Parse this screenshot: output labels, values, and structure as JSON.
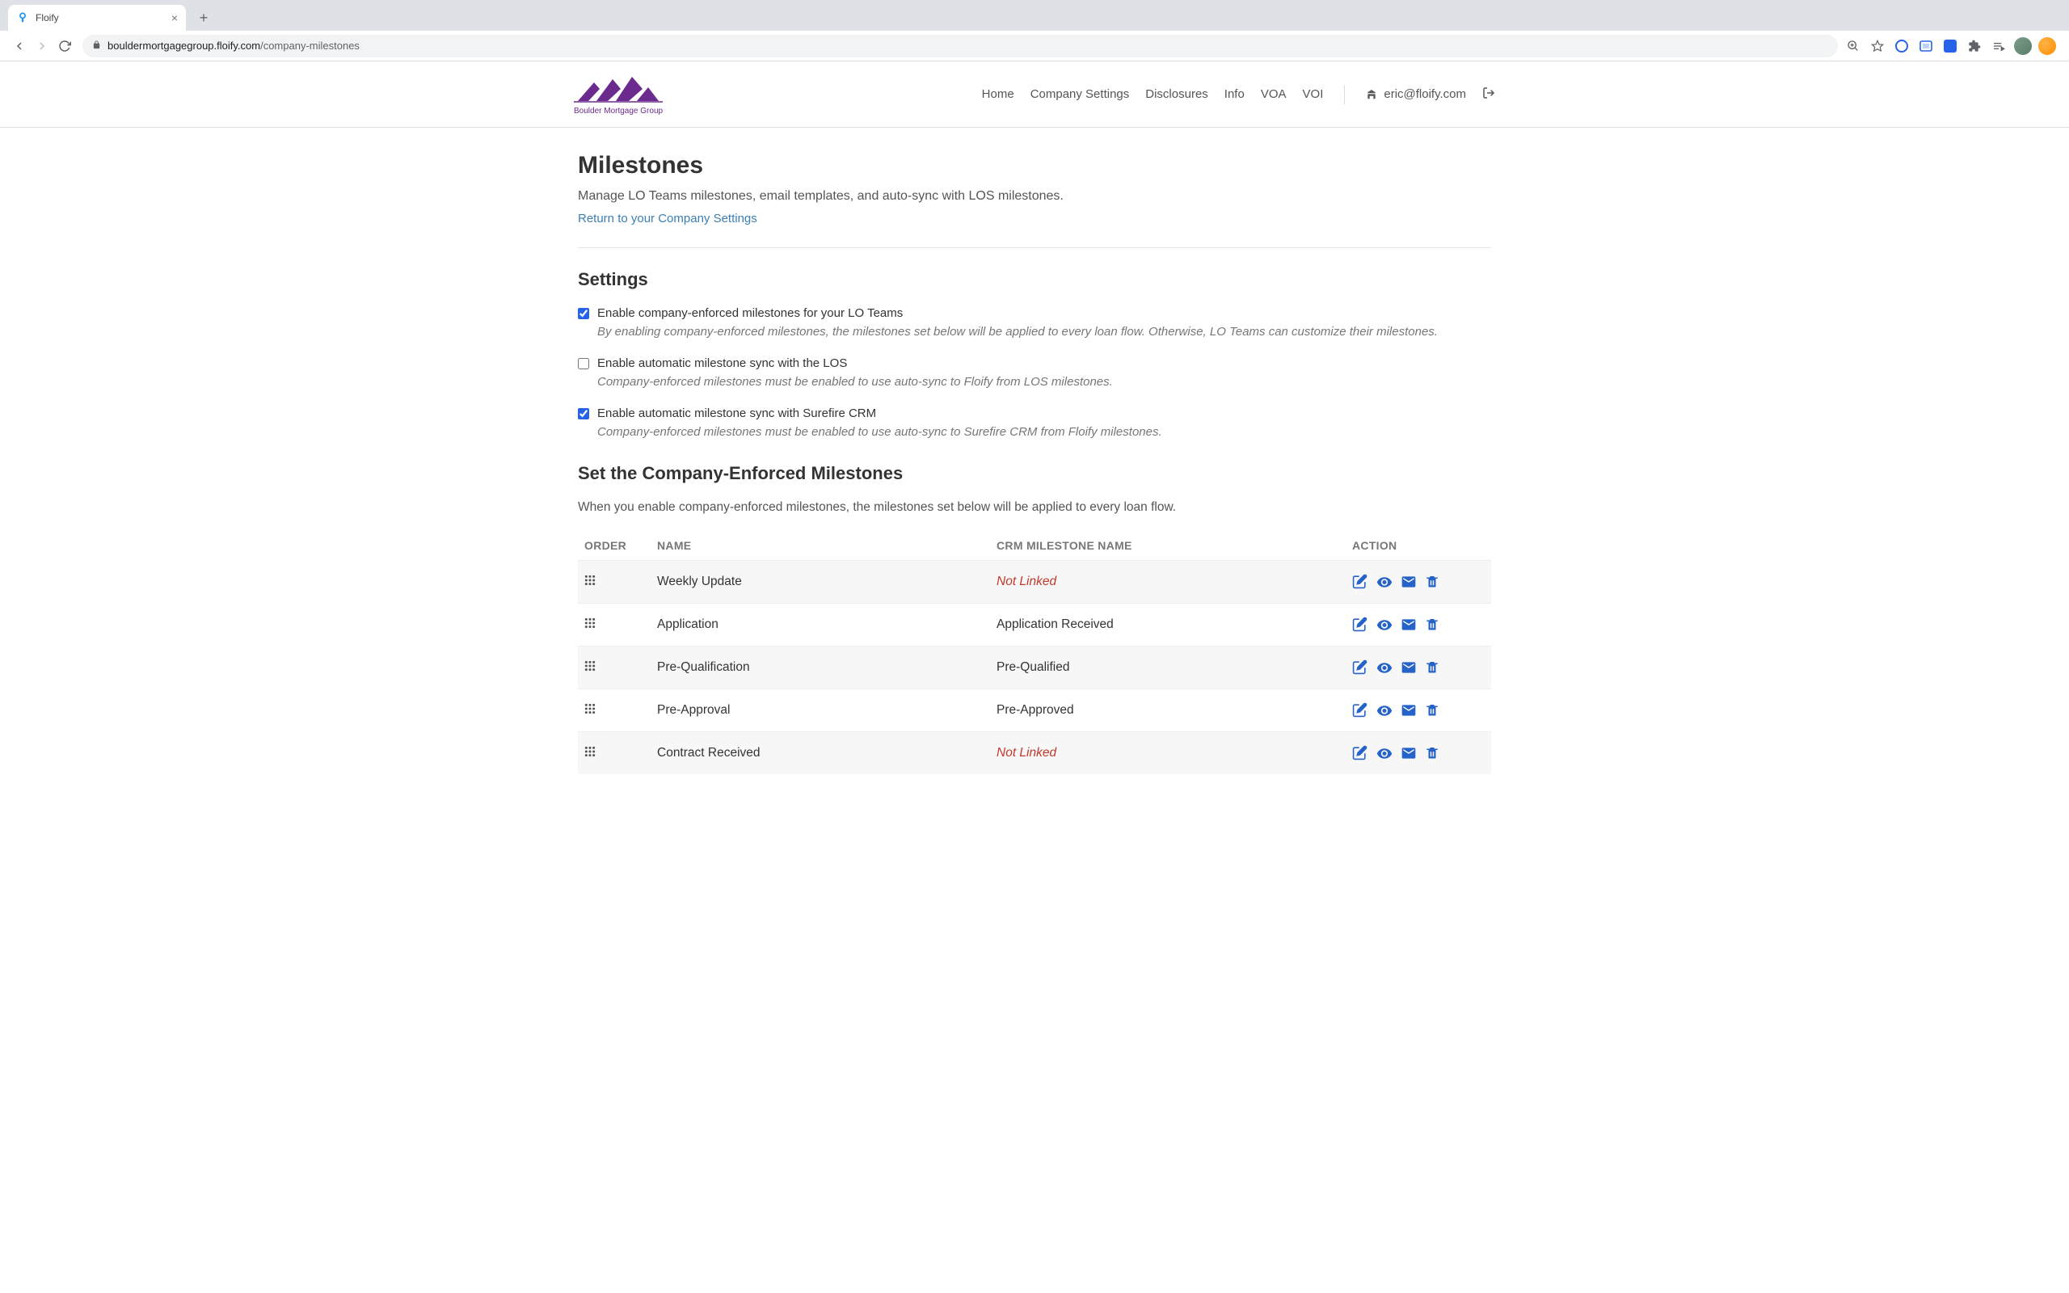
{
  "browser": {
    "tab_title": "Floify",
    "url_domain": "bouldermortgagegroup.floify.com",
    "url_path": "/company-milestones"
  },
  "logo_text": "Boulder Mortgage Group",
  "nav": {
    "home": "Home",
    "company_settings": "Company Settings",
    "disclosures": "Disclosures",
    "info": "Info",
    "voa": "VOA",
    "voi": "VOI",
    "user_email": "eric@floify.com"
  },
  "page": {
    "title": "Milestones",
    "subtitle": "Manage LO Teams milestones, email templates, and auto-sync with LOS milestones.",
    "return_link": "Return to your Company Settings"
  },
  "settings": {
    "heading": "Settings",
    "items": [
      {
        "label": "Enable company-enforced milestones for your LO Teams",
        "desc": "By enabling company-enforced milestones, the milestones set below will be applied to every loan flow. Otherwise, LO Teams can customize their milestones.",
        "checked": true
      },
      {
        "label": "Enable automatic milestone sync with the LOS",
        "desc": "Company-enforced milestones must be enabled to use auto-sync to Floify from LOS milestones.",
        "checked": false
      },
      {
        "label": "Enable automatic milestone sync with Surefire CRM",
        "desc": "Company-enforced milestones must be enabled to use auto-sync to Surefire CRM from Floify milestones.",
        "checked": true
      }
    ]
  },
  "milestones": {
    "heading": "Set the Company-Enforced Milestones",
    "subtitle": "When you enable company-enforced milestones, the milestones set below will be applied to every loan flow.",
    "columns": {
      "order": "ORDER",
      "name": "NAME",
      "crm": "CRM MILESTONE NAME",
      "action": "ACTION"
    },
    "not_linked_text": "Not Linked",
    "rows": [
      {
        "name": "Weekly Update",
        "crm": null
      },
      {
        "name": "Application",
        "crm": "Application Received"
      },
      {
        "name": "Pre-Qualification",
        "crm": "Pre-Qualified"
      },
      {
        "name": "Pre-Approval",
        "crm": "Pre-Approved"
      },
      {
        "name": "Contract Received",
        "crm": null
      }
    ]
  }
}
